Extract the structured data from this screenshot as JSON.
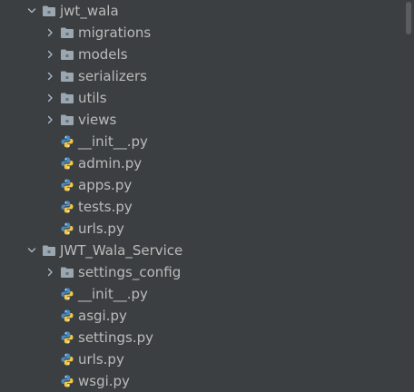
{
  "tree": {
    "items": [
      {
        "label": "jwt_wala",
        "kind": "package",
        "expanded": true,
        "depth": 0
      },
      {
        "label": "migrations",
        "kind": "package",
        "expanded": false,
        "depth": 1
      },
      {
        "label": "models",
        "kind": "package",
        "expanded": false,
        "depth": 1
      },
      {
        "label": "serializers",
        "kind": "package",
        "expanded": false,
        "depth": 1
      },
      {
        "label": "utils",
        "kind": "package",
        "expanded": false,
        "depth": 1
      },
      {
        "label": "views",
        "kind": "package",
        "expanded": false,
        "depth": 1
      },
      {
        "label": "__init__.py",
        "kind": "python-file",
        "depth": 1
      },
      {
        "label": "admin.py",
        "kind": "python-file",
        "depth": 1
      },
      {
        "label": "apps.py",
        "kind": "python-file",
        "depth": 1
      },
      {
        "label": "tests.py",
        "kind": "python-file",
        "depth": 1
      },
      {
        "label": "urls.py",
        "kind": "python-file",
        "depth": 1
      },
      {
        "label": "JWT_Wala_Service",
        "kind": "package",
        "expanded": true,
        "depth": 0
      },
      {
        "label": "settings_config",
        "kind": "package",
        "expanded": false,
        "depth": 1
      },
      {
        "label": "__init__.py",
        "kind": "python-file",
        "depth": 1
      },
      {
        "label": "asgi.py",
        "kind": "python-file",
        "depth": 1
      },
      {
        "label": "settings.py",
        "kind": "python-file",
        "depth": 1
      },
      {
        "label": "urls.py",
        "kind": "python-file",
        "depth": 1
      },
      {
        "label": "wsgi.py",
        "kind": "python-file",
        "depth": 1
      }
    ]
  },
  "colors": {
    "background": "#3c3f41",
    "text": "#bbbbbb",
    "folder": "#9aa7b0",
    "python_blue": "#4a8bc4",
    "python_yellow": "#f0c94a",
    "arrow": "#a9b7c6"
  }
}
